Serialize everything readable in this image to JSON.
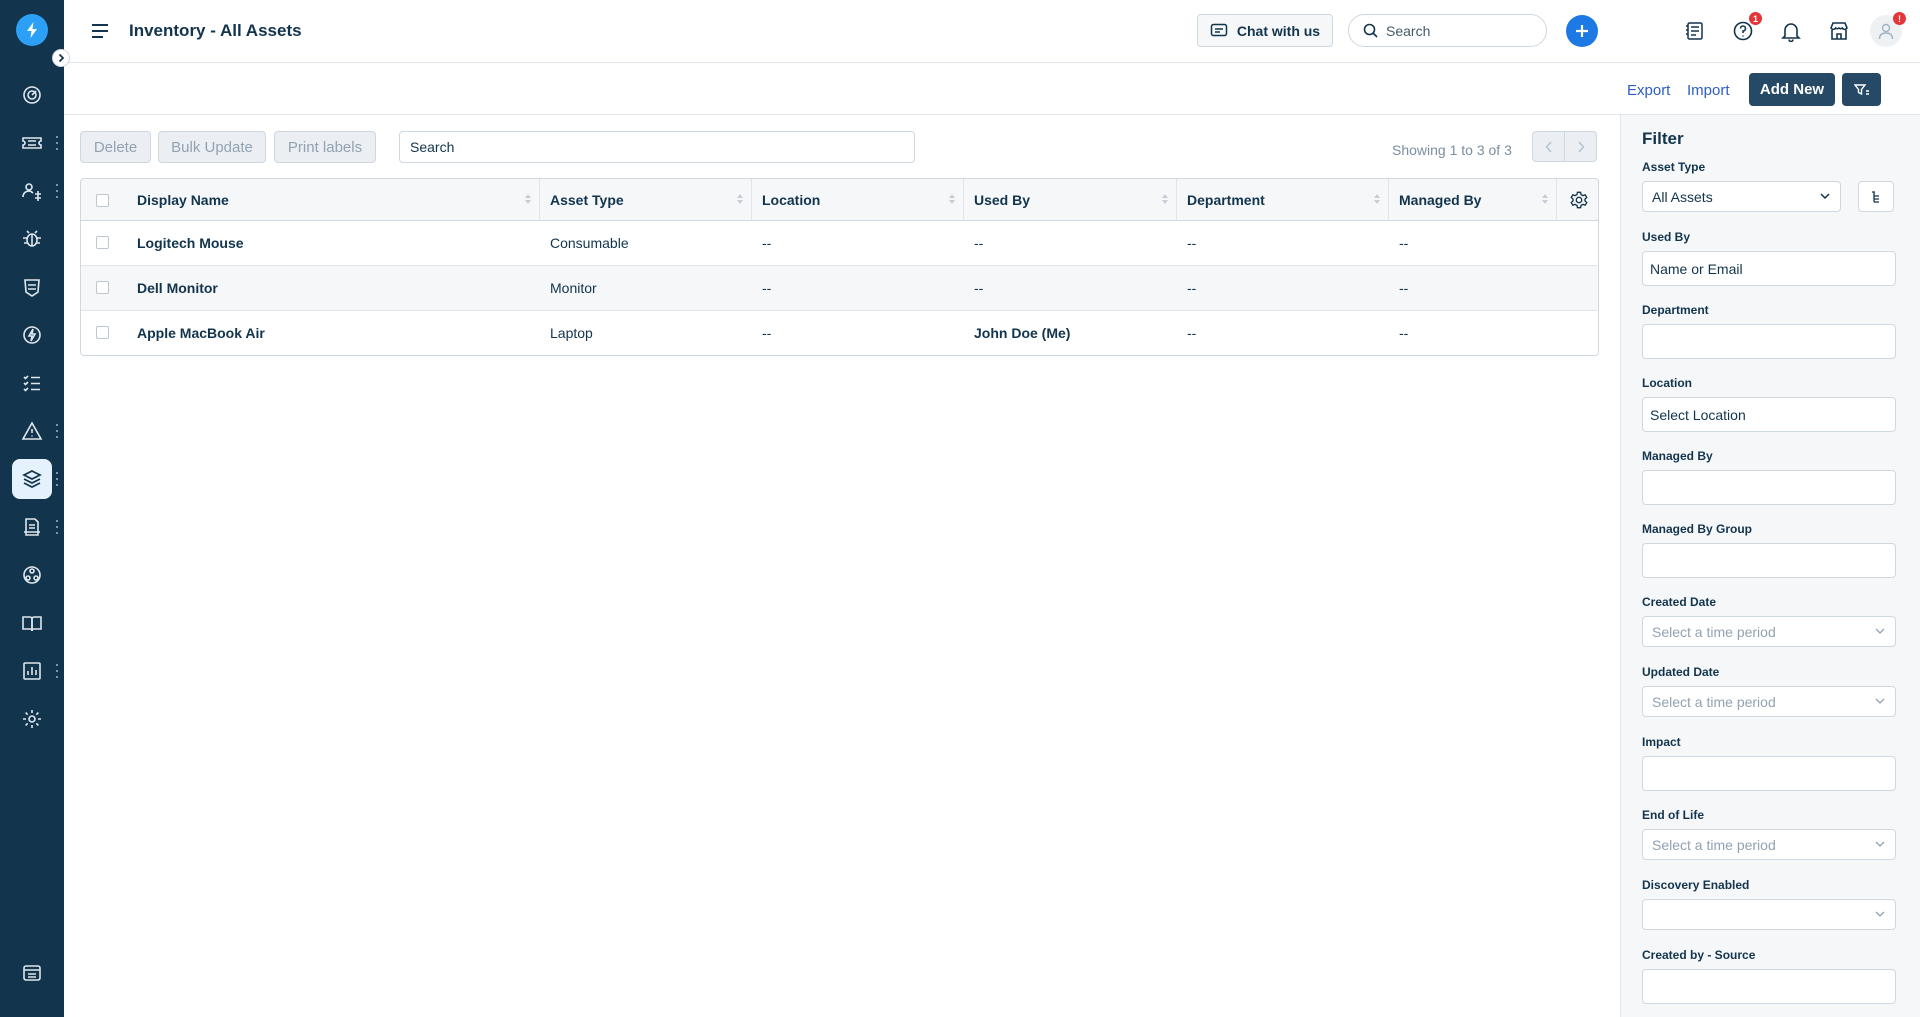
{
  "header": {
    "title": "Inventory - All Assets",
    "chat_label": "Chat with us",
    "search_placeholder": "Search",
    "help_badge": "1",
    "avatar_badge": "!"
  },
  "sidebar": {
    "items": [
      {
        "icon": "dashboard-icon"
      },
      {
        "icon": "tickets-icon",
        "has_menu": true
      },
      {
        "icon": "contacts-icon",
        "has_menu": true
      },
      {
        "icon": "problems-icon"
      },
      {
        "icon": "changes-icon"
      },
      {
        "icon": "releases-icon"
      },
      {
        "icon": "tasks-icon"
      },
      {
        "icon": "alerts-icon",
        "has_menu": true
      },
      {
        "icon": "inventory-icon",
        "active": true,
        "has_menu": true
      },
      {
        "icon": "purchase-orders-icon",
        "has_menu": true
      },
      {
        "icon": "projects-icon"
      },
      {
        "icon": "solutions-icon"
      },
      {
        "icon": "analytics-icon",
        "has_menu": true
      },
      {
        "icon": "admin-icon"
      },
      {
        "icon": "service-catalog-icon"
      }
    ]
  },
  "actions": {
    "export_label": "Export",
    "import_label": "Import",
    "add_new_label": "Add New"
  },
  "toolbar": {
    "delete_label": "Delete",
    "bulk_update_label": "Bulk Update",
    "print_labels_label": "Print labels",
    "search_placeholder": "Search",
    "showing_text": "Showing 1 to 3 of 3"
  },
  "table": {
    "columns": [
      "Display Name",
      "Asset Type",
      "Location",
      "Used By",
      "Department",
      "Managed By"
    ],
    "rows": [
      {
        "name": "Logitech Mouse",
        "type": "Consumable",
        "location": "--",
        "used_by": "--",
        "department": "--",
        "managed_by": "--"
      },
      {
        "name": "Dell Monitor",
        "type": "Monitor",
        "location": "--",
        "used_by": "--",
        "department": "--",
        "managed_by": "--"
      },
      {
        "name": "Apple MacBook Air",
        "type": "Laptop",
        "location": "--",
        "used_by": "John Doe (Me)",
        "department": "--",
        "managed_by": "--"
      }
    ]
  },
  "filter": {
    "title": "Filter",
    "asset_type_label": "Asset Type",
    "asset_type_value": "All Assets",
    "used_by_label": "Used By",
    "used_by_value": "Name or Email",
    "department_label": "Department",
    "location_label": "Location",
    "location_value": "Select Location",
    "managed_by_label": "Managed By",
    "managed_by_group_label": "Managed By Group",
    "created_date_label": "Created Date",
    "created_date_placeholder": "Select a time period",
    "updated_date_label": "Updated Date",
    "updated_date_placeholder": "Select a time period",
    "impact_label": "Impact",
    "end_of_life_label": "End of Life",
    "end_of_life_placeholder": "Select a time period",
    "discovery_enabled_label": "Discovery Enabled",
    "created_by_source_label": "Created by - Source"
  },
  "colors": {
    "sidebar": "#12344d",
    "accent": "#1d7ae5",
    "primary_button": "#264966",
    "link": "#2c5cc5",
    "badge": "#e43538"
  }
}
